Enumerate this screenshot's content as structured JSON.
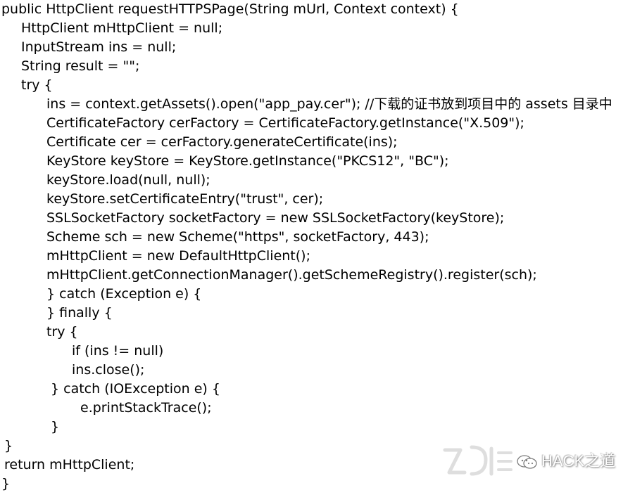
{
  "code_lines": [
    {
      "text": "public HttpClient requestHTTPSPage(String mUrl, Context context) {"
    },
    {
      "text": "HttpClient mHttpClient = null;"
    },
    {
      "text": "InputStream ins = null;"
    },
    {
      "text": "String result = \"\";"
    },
    {
      "text": "try {"
    },
    {
      "text": "ins = context.getAssets().open(\"app_pay.cer\"); //下载的证书放到项目中的 assets 目录中"
    },
    {
      "text": "CertificateFactory cerFactory = CertificateFactory.getInstance(\"X.509\");"
    },
    {
      "text": "Certificate cer = cerFactory.generateCertificate(ins);"
    },
    {
      "text": "KeyStore keyStore = KeyStore.getInstance(\"PKCS12\", \"BC\");"
    },
    {
      "text": "keyStore.load(null, null);"
    },
    {
      "text": "keyStore.setCertificateEntry(\"trust\", cer);"
    },
    {
      "text": "SSLSocketFactory socketFactory = new SSLSocketFactory(keyStore);"
    },
    {
      "text": "Scheme sch = new Scheme(\"https\", socketFactory, 443);"
    },
    {
      "text": "mHttpClient = new DefaultHttpClient();"
    },
    {
      "text": "mHttpClient.getConnectionManager().getSchemeRegistry().register(sch);"
    },
    {
      "text": "} catch (Exception e) {"
    },
    {
      "text": "} finally {"
    },
    {
      "text": "try {"
    },
    {
      "text": "if (ins != null)"
    },
    {
      "text": "ins.close();"
    },
    {
      "text": "} catch (IOException e) {"
    },
    {
      "text": "e.printStackTrace();"
    },
    {
      "text": "}"
    },
    {
      "text": "}"
    },
    {
      "text": "return mHttpClient;"
    },
    {
      "text": "}"
    }
  ],
  "watermark": {
    "text": "HACK之道",
    "icon": "wechat-icon",
    "logo": "logo-watermark"
  }
}
